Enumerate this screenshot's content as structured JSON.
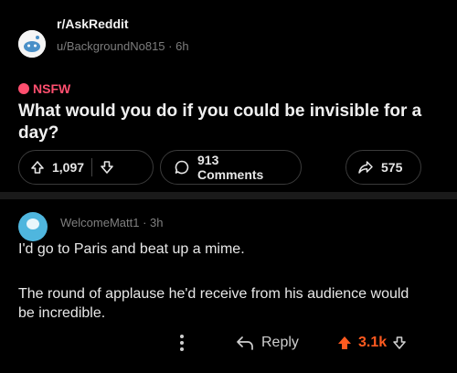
{
  "post": {
    "subreddit": "r/AskReddit",
    "author_line": "u/BackgroundNo815 · 6h",
    "nsfw_label": "NSFW",
    "title": "What would you do if you could be invisible for a day?",
    "actions": {
      "upvotes": "1,097",
      "comments": "913 Comments",
      "shares": "575"
    }
  },
  "comment": {
    "author_line": "WelcomeMatt1 · 3h",
    "line1": "I'd go to Paris and beat up a mime.",
    "line2": "The round of applause he'd receive from his audience would be incredible.",
    "reply_label": "Reply",
    "score": "3.1k"
  },
  "colors": {
    "background": "#000000",
    "nsfw": "#ff4f6f",
    "upvote_active": "#ff5a1f",
    "avatar": "#4fb6de"
  },
  "icons": [
    "subreddit-avatar",
    "nsfw-dot-icon",
    "upvote-icon",
    "downvote-icon",
    "comment-icon",
    "share-icon",
    "more-icon",
    "reply-icon"
  ]
}
